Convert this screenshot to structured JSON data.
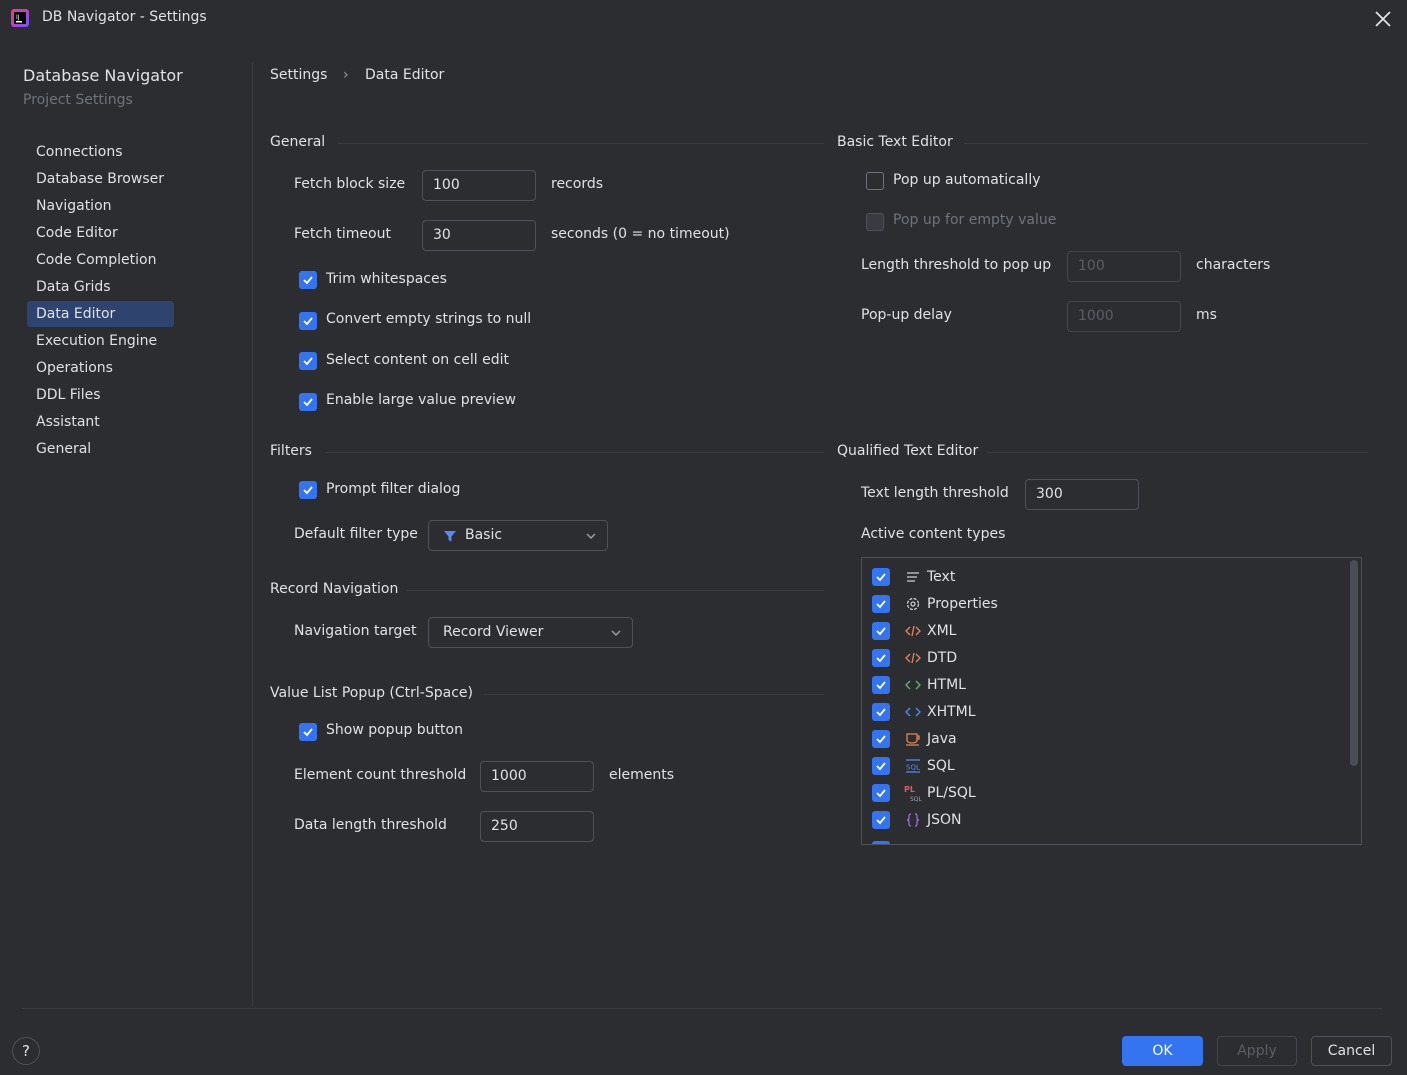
{
  "window": {
    "title": "DB Navigator - Settings"
  },
  "sidebar": {
    "title": "Database Navigator",
    "subtitle": "Project Settings",
    "items": [
      {
        "label": "Connections"
      },
      {
        "label": "Database Browser"
      },
      {
        "label": "Navigation"
      },
      {
        "label": "Code Editor"
      },
      {
        "label": "Code Completion"
      },
      {
        "label": "Data Grids"
      },
      {
        "label": "Data Editor",
        "selected": true
      },
      {
        "label": "Execution Engine"
      },
      {
        "label": "Operations"
      },
      {
        "label": "DDL Files"
      },
      {
        "label": "Assistant"
      },
      {
        "label": "General"
      }
    ]
  },
  "breadcrumb": {
    "root": "Settings",
    "separator": "›",
    "current": "Data Editor"
  },
  "general": {
    "title": "General",
    "fetch_block_size": {
      "label": "Fetch block size",
      "value": "100",
      "unit": "records"
    },
    "fetch_timeout": {
      "label": "Fetch timeout",
      "value": "30",
      "unit": "seconds (0 = no timeout)"
    },
    "trim_whitespaces": {
      "label": "Trim whitespaces",
      "checked": true
    },
    "convert_empty": {
      "label": "Convert empty strings to null",
      "checked": true
    },
    "select_content": {
      "label": "Select content on cell edit",
      "checked": true
    },
    "large_preview": {
      "label": "Enable large value preview",
      "checked": true
    }
  },
  "filters": {
    "title": "Filters",
    "prompt_filter": {
      "label": "Prompt filter dialog",
      "checked": true
    },
    "default_filter_type": {
      "label": "Default filter type",
      "value": "Basic"
    }
  },
  "record_navigation": {
    "title": "Record Navigation",
    "target": {
      "label": "Navigation target",
      "value": "Record Viewer"
    }
  },
  "value_list": {
    "title": "Value List Popup (Ctrl-Space)",
    "show_popup": {
      "label": "Show popup button",
      "checked": true
    },
    "element_count": {
      "label": "Element count threshold",
      "value": "1000",
      "unit": "elements"
    },
    "data_length": {
      "label": "Data length threshold",
      "value": "250"
    }
  },
  "basic_text_editor": {
    "title": "Basic Text Editor",
    "popup_auto": {
      "label": "Pop up automatically",
      "checked": false
    },
    "popup_empty": {
      "label": "Pop up for empty value",
      "checked": false
    },
    "length_threshold": {
      "label": "Length threshold to pop up",
      "value": "100",
      "unit": "characters"
    },
    "popup_delay": {
      "label": "Pop-up delay",
      "value": "1000",
      "unit": "ms"
    }
  },
  "qualified_text_editor": {
    "title": "Qualified Text Editor",
    "text_length": {
      "label": "Text length threshold",
      "value": "300"
    },
    "active_types_label": "Active content types",
    "content_types": [
      {
        "label": "Text",
        "icon": "text-lines-icon",
        "checked": true
      },
      {
        "label": "Properties",
        "icon": "gear-icon",
        "checked": true
      },
      {
        "label": "XML",
        "icon": "xml-tag-icon",
        "checked": true
      },
      {
        "label": "DTD",
        "icon": "dtd-tag-icon",
        "checked": true
      },
      {
        "label": "HTML",
        "icon": "html-brackets-icon",
        "checked": true
      },
      {
        "label": "XHTML",
        "icon": "xhtml-brackets-icon",
        "checked": true
      },
      {
        "label": "Java",
        "icon": "java-cup-icon",
        "checked": true
      },
      {
        "label": "SQL",
        "icon": "sql-icon",
        "checked": true
      },
      {
        "label": "PL/SQL",
        "icon": "plsql-icon",
        "checked": true
      },
      {
        "label": "JSON",
        "icon": "json-braces-icon",
        "checked": true
      }
    ]
  },
  "buttons": {
    "ok": "OK",
    "apply": "Apply",
    "cancel": "Cancel",
    "help": "?"
  },
  "colors": {
    "accent": "#3574f0",
    "background": "#2b2d30",
    "selection": "#2e436e",
    "text": "#dfe1e5",
    "muted": "#6f737a"
  }
}
